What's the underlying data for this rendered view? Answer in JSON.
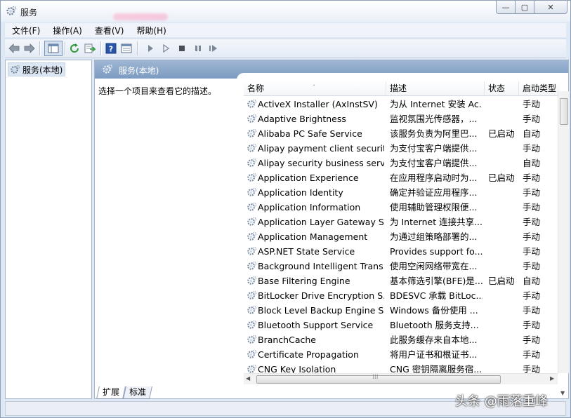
{
  "window": {
    "title": "服务",
    "min_glyph": "—",
    "max_glyph": "▢",
    "close_glyph": "✕"
  },
  "menu": [
    "文件(F)",
    "操作(A)",
    "查看(V)",
    "帮助(H)"
  ],
  "toolbar": {
    "icons": [
      "back-arrow-icon",
      "forward-arrow-icon",
      "console-tree-icon",
      "refresh-icon",
      "export-list-icon",
      "help-icon",
      "properties-icon",
      "start-service-icon",
      "start-service-alt-icon",
      "stop-service-icon",
      "pause-service-icon",
      "restart-service-icon"
    ]
  },
  "tree": {
    "root_label": "服务(本地)"
  },
  "panel": {
    "header": "服务(本地)",
    "description_prompt": "选择一个项目来查看它的描述。"
  },
  "columns": {
    "name": "名称",
    "desc": "描述",
    "status": "状态",
    "start": "启动类型",
    "sort_glyph": "˄"
  },
  "services": [
    {
      "name": "ActiveX Installer (AxInstSV)",
      "desc": "为从 Internet 安装 Ac...",
      "status": "",
      "start": "手动"
    },
    {
      "name": "Adaptive Brightness",
      "desc": "监视氛围光传感器，...",
      "status": "",
      "start": "手动"
    },
    {
      "name": "Alibaba PC Safe Service",
      "desc": "该服务负责为阿里巴...",
      "status": "已启动",
      "start": "自动"
    },
    {
      "name": "Alipay payment client securit...",
      "desc": "为支付宝客户端提供...",
      "status": "",
      "start": "手动"
    },
    {
      "name": "Alipay security business servi...",
      "desc": "为支付宝客户端提供...",
      "status": "",
      "start": "自动"
    },
    {
      "name": "Application Experience",
      "desc": "在应用程序启动时为...",
      "status": "已启动",
      "start": "手动"
    },
    {
      "name": "Application Identity",
      "desc": "确定并验证应用程序...",
      "status": "",
      "start": "手动"
    },
    {
      "name": "Application Information",
      "desc": "使用辅助管理权限便...",
      "status": "",
      "start": "手动"
    },
    {
      "name": "Application Layer Gateway S...",
      "desc": "为 Internet 连接共享...",
      "status": "",
      "start": "手动"
    },
    {
      "name": "Application Management",
      "desc": "为通过组策略部署的...",
      "status": "",
      "start": "手动"
    },
    {
      "name": "ASP.NET State Service",
      "desc": "Provides support fo...",
      "status": "",
      "start": "手动"
    },
    {
      "name": "Background Intelligent Trans...",
      "desc": "使用空闲网络带宽在...",
      "status": "",
      "start": "手动"
    },
    {
      "name": "Base Filtering Engine",
      "desc": "基本筛选引擎(BFE)是...",
      "status": "已启动",
      "start": "自动"
    },
    {
      "name": "BitLocker Drive Encryption S...",
      "desc": "BDESVC 承载 BitLoc...",
      "status": "",
      "start": "手动"
    },
    {
      "name": "Block Level Backup Engine S...",
      "desc": "Windows 备份使用 ...",
      "status": "",
      "start": "手动"
    },
    {
      "name": "Bluetooth Support Service",
      "desc": "Bluetooth 服务支持...",
      "status": "",
      "start": "手动"
    },
    {
      "name": "BranchCache",
      "desc": "此服务缓存来自本地...",
      "status": "",
      "start": "手动"
    },
    {
      "name": "Certificate Propagation",
      "desc": "将用户证书和根证书...",
      "status": "",
      "start": "手动"
    },
    {
      "name": "CNG Key Isolation",
      "desc": "CNG 密钥隔离服务宿...",
      "status": "",
      "start": "手动"
    }
  ],
  "scroll": {
    "up_glyph": "▲",
    "down_glyph": "▼",
    "left_glyph": "◀",
    "right_glyph": "▶",
    "grip_glyph": "⁞⁞⁞"
  },
  "tabs": [
    "扩展",
    "标准"
  ],
  "watermark": "头条 @雨落重峰",
  "colors": {
    "header_gradient_top": "#9fb6d3",
    "header_gradient_bottom": "#7c9bc1",
    "window_bg": "#dfe9f5"
  }
}
